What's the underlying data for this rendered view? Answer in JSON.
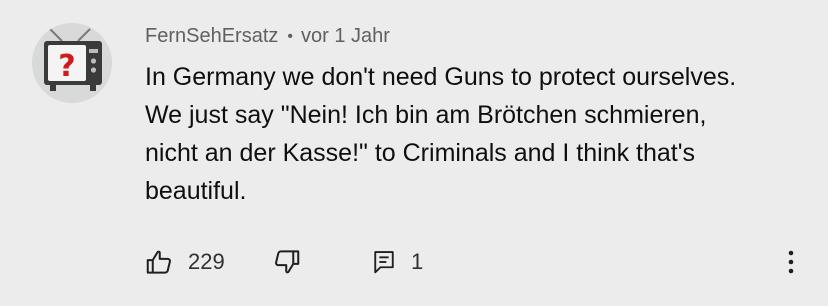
{
  "comment": {
    "author": "FernSehErsatz",
    "separator": "•",
    "time": "vor 1 Jahr",
    "text_lines": [
      "In Germany we don't need Guns to protect ourselves.",
      "We just say \"Nein! Ich bin am Brötchen schmieren,",
      "nicht an der Kasse!\" to Criminals and I think that's",
      "beautiful."
    ],
    "avatar_icon": "tv-question-mark-icon"
  },
  "actions": {
    "like_icon": "thumbs-up-icon",
    "like_count": "229",
    "dislike_icon": "thumbs-down-icon",
    "reply_icon": "reply-comment-icon",
    "reply_count": "1",
    "more_icon": "more-vertical-icon"
  }
}
